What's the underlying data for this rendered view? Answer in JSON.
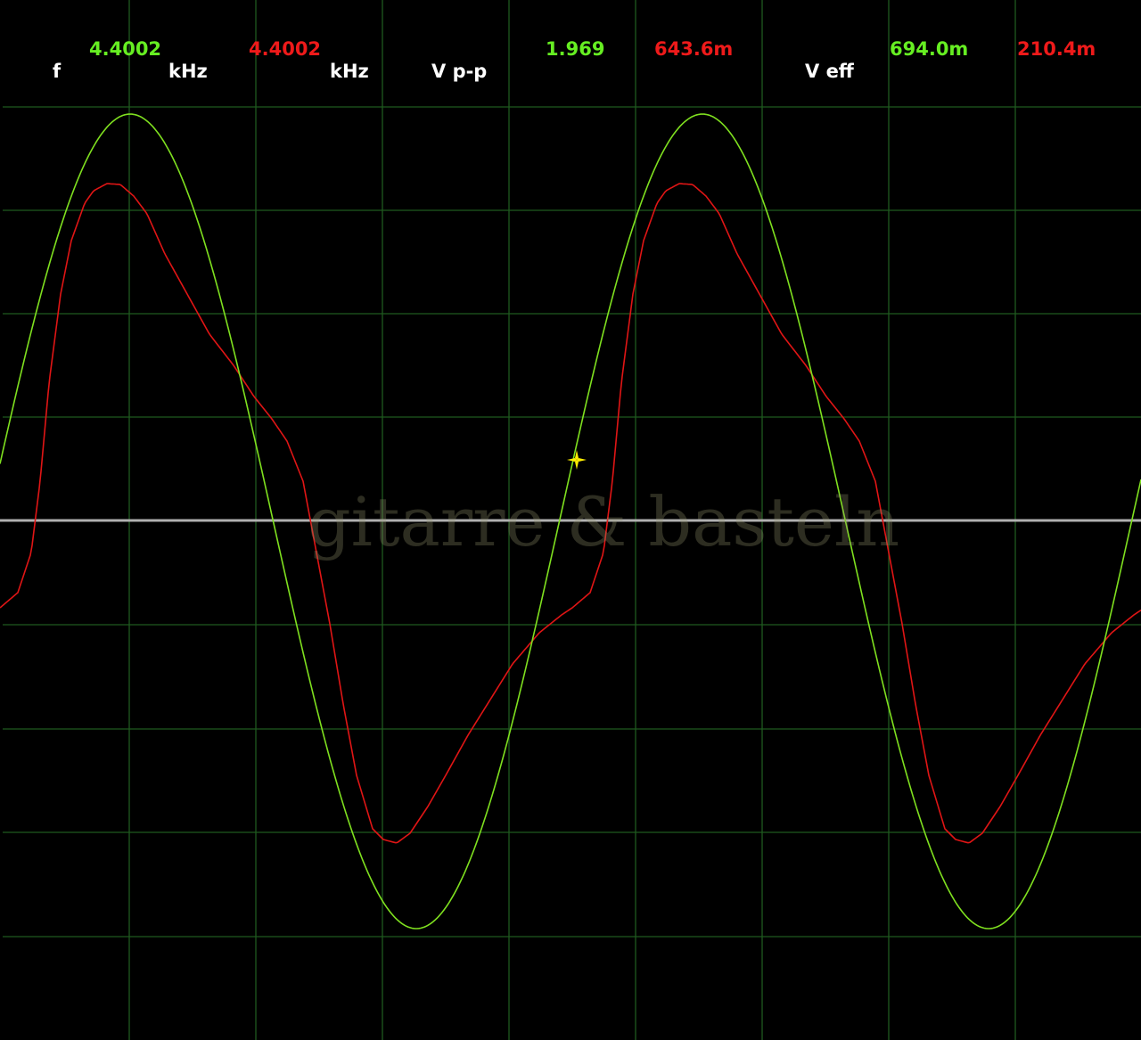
{
  "readouts": {
    "frequency": {
      "label": "f",
      "ch1_value": "4.4002",
      "ch1_unit": "kHz",
      "ch2_value": "4.4002",
      "ch2_unit": "kHz"
    },
    "vpp": {
      "label": "V p-p",
      "ch1_value": "1.969",
      "ch2_value": "643.6m"
    },
    "veff": {
      "label": "V eff",
      "ch1_value": "694.0m",
      "ch2_value": "210.4m"
    }
  },
  "watermark": "gitarre & basteln",
  "colors": {
    "background": "#000000",
    "grid": "#1f5a1f",
    "ch1": "#7fe01f",
    "ch2": "#e01515",
    "zero_line": "#b0b0b0",
    "cursor": "#ffee00",
    "label": "#ffffff"
  },
  "icons": {
    "cursor": "crosshair-cursor-icon"
  },
  "chart_data": {
    "type": "line",
    "grid": true,
    "grid_divisions": {
      "x": 9,
      "y": 8
    },
    "series": [
      {
        "channel": "ch1",
        "shape": "sine",
        "frequency_khz": 4.4002,
        "vpp": 1.969,
        "veff": 0.694,
        "color": "#7fe01f"
      },
      {
        "channel": "ch2",
        "shape": "distorted-sine",
        "frequency_khz": 4.4002,
        "vpp": 0.6436,
        "veff": 0.2104,
        "color": "#e01515"
      }
    ],
    "cycles_visible": 2
  }
}
